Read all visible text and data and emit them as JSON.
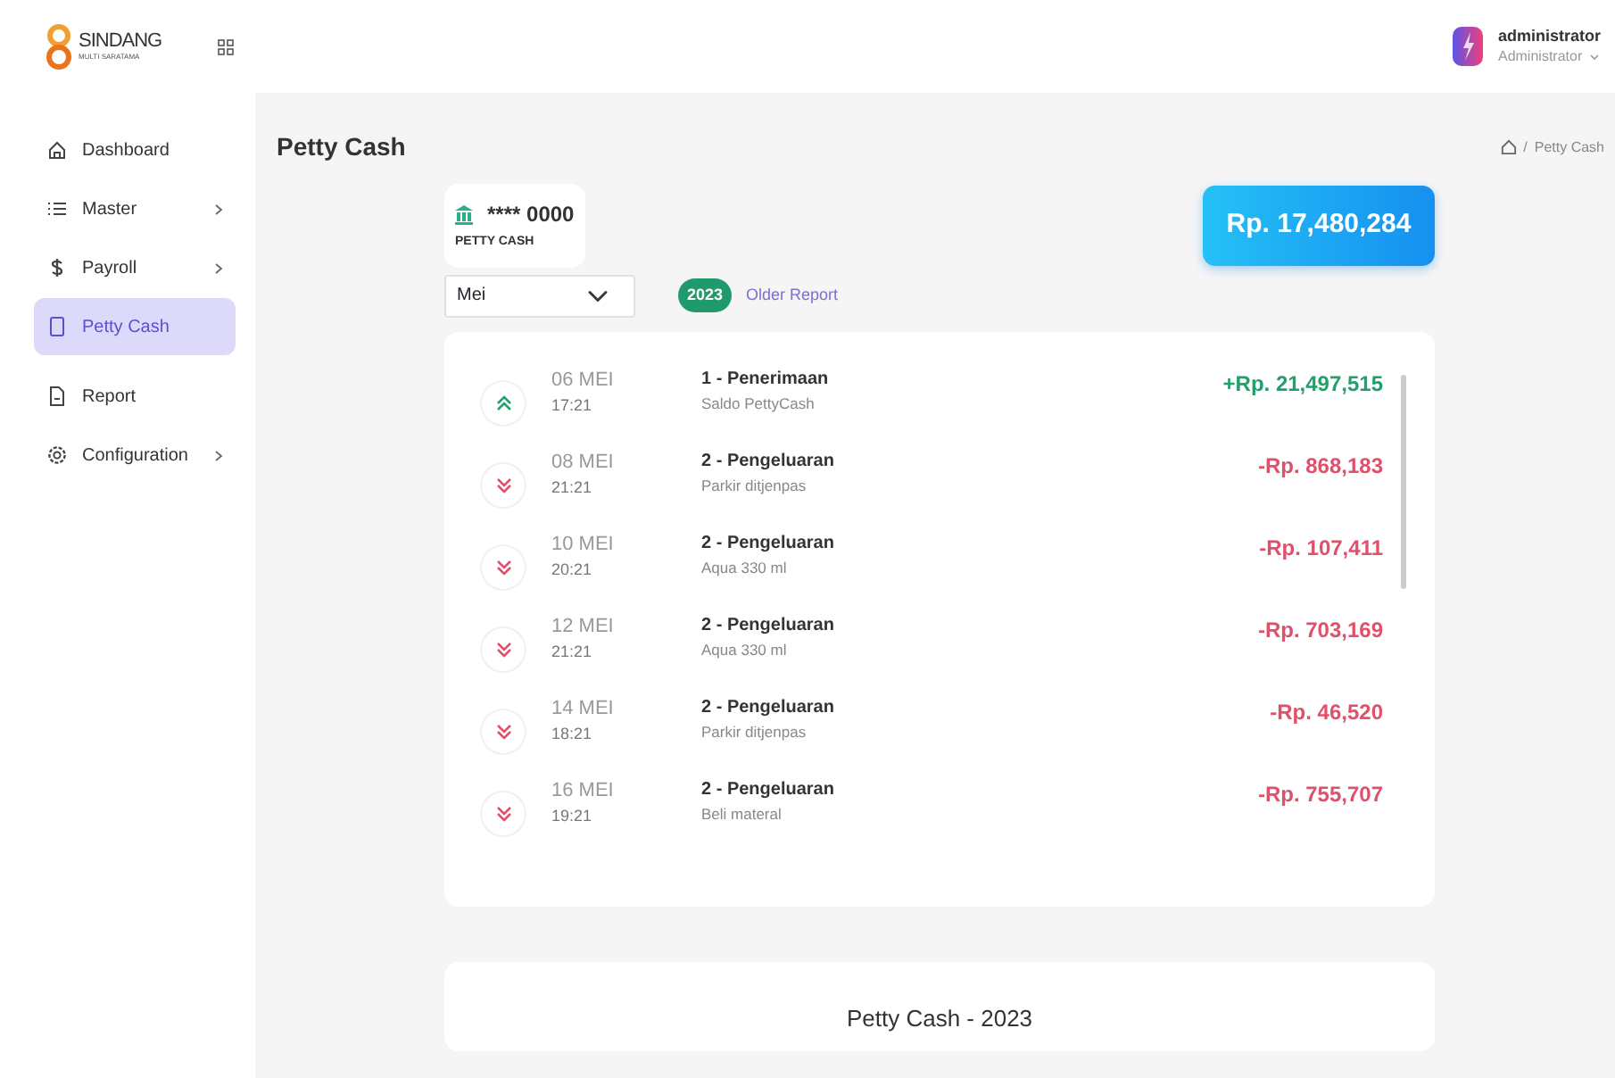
{
  "brand": {
    "name": "SINDANG",
    "tagline": "MULTI SARATAMA"
  },
  "user": {
    "name": "administrator",
    "role": "Administrator"
  },
  "sidebar": {
    "items": [
      {
        "label": "Dashboard",
        "submenu": false,
        "selected": false
      },
      {
        "label": "Master",
        "submenu": true,
        "selected": false
      },
      {
        "label": "Payroll",
        "submenu": true,
        "selected": false
      },
      {
        "label": "Petty Cash",
        "submenu": false,
        "selected": true
      },
      {
        "label": "Report",
        "submenu": false,
        "selected": false
      },
      {
        "label": "Configuration",
        "submenu": true,
        "selected": false
      }
    ]
  },
  "page": {
    "title": "Petty Cash",
    "breadcrumb": [
      "/",
      "Petty Cash"
    ]
  },
  "account": {
    "number": "**** 0000",
    "name": "PETTY CASH"
  },
  "balance": "Rp. 17,480,284",
  "month_select": {
    "value": "Mei"
  },
  "year_badge": "2023",
  "older_report_link": "Older Report",
  "transactions": [
    {
      "kind": "in",
      "date": "06 MEI",
      "time": "17:21",
      "title": "1 - Penerimaan",
      "note": "Saldo PettyCash",
      "amount": "+Rp. 21,497,515"
    },
    {
      "kind": "out",
      "date": "08 MEI",
      "time": "21:21",
      "title": "2 - Pengeluaran",
      "note": "Parkir ditjenpas",
      "amount": "-Rp. 868,183"
    },
    {
      "kind": "out",
      "date": "10 MEI",
      "time": "20:21",
      "title": "2 - Pengeluaran",
      "note": "Aqua 330 ml",
      "amount": "-Rp. 107,411"
    },
    {
      "kind": "out",
      "date": "12 MEI",
      "time": "21:21",
      "title": "2 - Pengeluaran",
      "note": "Aqua 330 ml",
      "amount": "-Rp. 703,169"
    },
    {
      "kind": "out",
      "date": "14 MEI",
      "time": "18:21",
      "title": "2 - Pengeluaran",
      "note": "Parkir ditjenpas",
      "amount": "-Rp. 46,520"
    },
    {
      "kind": "out",
      "date": "16 MEI",
      "time": "19:21",
      "title": "2 - Pengeluaran",
      "note": "Beli materal",
      "amount": "-Rp. 755,707"
    }
  ],
  "report_card": {
    "title": "Petty Cash - 2023"
  }
}
